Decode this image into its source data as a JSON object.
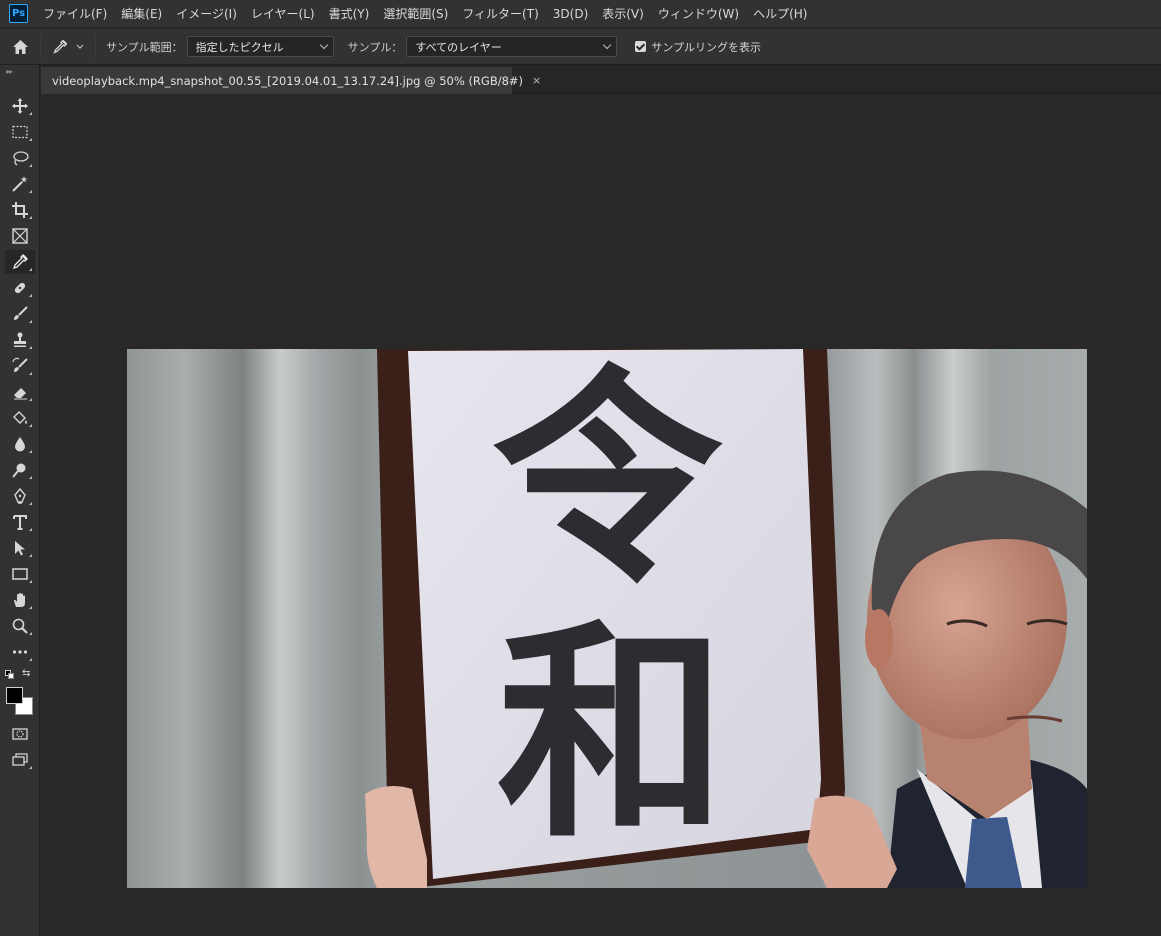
{
  "app": {
    "logo_text": "Ps"
  },
  "menu": {
    "items": [
      {
        "label": "ファイル(F)"
      },
      {
        "label": "編集(E)"
      },
      {
        "label": "イメージ(I)"
      },
      {
        "label": "レイヤー(L)"
      },
      {
        "label": "書式(Y)"
      },
      {
        "label": "選択範囲(S)"
      },
      {
        "label": "フィルター(T)"
      },
      {
        "label": "3D(D)"
      },
      {
        "label": "表示(V)"
      },
      {
        "label": "ウィンドウ(W)"
      },
      {
        "label": "ヘルプ(H)"
      }
    ]
  },
  "options": {
    "sample_size_label": "サンプル範囲：",
    "sample_size_value": "指定したピクセル",
    "sample_label": "サンプル：",
    "sample_value": "すべてのレイヤー",
    "show_ring_label": "サンプルリングを表示",
    "show_ring_checked": true
  },
  "document": {
    "tab_title": "videoplayback.mp4_snapshot_00.55_[2019.04.01_13.17.24].jpg @ 50% (RGB/8#)",
    "close_glyph": "×",
    "image_text_top": "令",
    "image_text_bottom": "和"
  },
  "toolbar": {
    "active_tool": "eyedropper",
    "foreground_color": "#000000",
    "background_color": "#ffffff",
    "tools": [
      {
        "name": "move-tool-icon"
      },
      {
        "name": "marquee-tool-icon"
      },
      {
        "name": "lasso-tool-icon"
      },
      {
        "name": "magic-wand-tool-icon"
      },
      {
        "name": "crop-tool-icon"
      },
      {
        "name": "frame-tool-icon"
      },
      {
        "name": "eyedropper-tool-icon"
      },
      {
        "name": "healing-brush-tool-icon"
      },
      {
        "name": "brush-tool-icon"
      },
      {
        "name": "clone-stamp-tool-icon"
      },
      {
        "name": "history-brush-tool-icon"
      },
      {
        "name": "eraser-tool-icon"
      },
      {
        "name": "paint-bucket-tool-icon"
      },
      {
        "name": "blur-tool-icon"
      },
      {
        "name": "dodge-tool-icon"
      },
      {
        "name": "pen-tool-icon"
      },
      {
        "name": "type-tool-icon"
      },
      {
        "name": "path-selection-tool-icon"
      },
      {
        "name": "rectangle-tool-icon"
      },
      {
        "name": "hand-tool-icon"
      },
      {
        "name": "zoom-tool-icon"
      },
      {
        "name": "more-tools-icon"
      }
    ]
  }
}
